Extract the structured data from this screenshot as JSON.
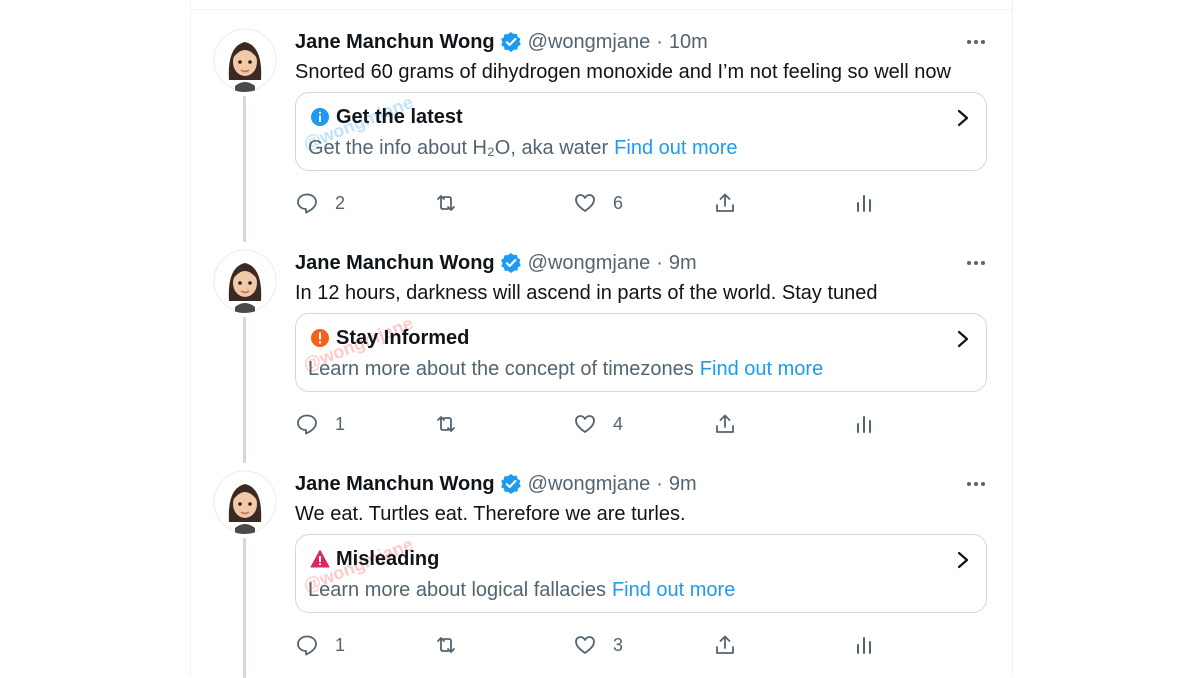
{
  "colors": {
    "accent": "#1d9bf0",
    "text": "#0f1419",
    "secondary": "#536471",
    "border": "#cfd9de",
    "thread_line": "#cfd9de",
    "info_icon": "#1d9bf0",
    "stay_informed_icon": "#f4631e",
    "misleading_icon": "#e0245e"
  },
  "watermark": "@wongmjane",
  "tweets": [
    {
      "author": {
        "name": "Jane Manchun Wong",
        "handle": "@wongmjane",
        "verified": true,
        "avatar_icon": "memoji-avatar-icon"
      },
      "time": "10m",
      "text": "Snorted 60 grams of dihydrogen monoxide and I’m not feeling so well now",
      "card": {
        "icon": "info-icon",
        "title": "Get the latest",
        "body": "Get the info about H₂O, aka water",
        "link": "Find out more"
      },
      "actions": {
        "replies": "2",
        "retweets": "",
        "likes": "6"
      }
    },
    {
      "author": {
        "name": "Jane Manchun Wong",
        "handle": "@wongmjane",
        "verified": true,
        "avatar_icon": "memoji-avatar-icon"
      },
      "time": "9m",
      "text": "In 12 hours, darkness will ascend in parts of the world. Stay tuned",
      "card": {
        "icon": "exclamation-icon",
        "title": "Stay Informed",
        "body": "Learn more about the concept of timezones",
        "link": "Find out more"
      },
      "actions": {
        "replies": "1",
        "retweets": "",
        "likes": "4"
      }
    },
    {
      "author": {
        "name": "Jane Manchun Wong",
        "handle": "@wongmjane",
        "verified": true,
        "avatar_icon": "memoji-avatar-icon"
      },
      "time": "9m",
      "text": "We eat. Turtles eat. Therefore we are turles.",
      "card": {
        "icon": "warning-triangle-icon",
        "title": "Misleading",
        "body": "Learn more about logical fallacies",
        "link": "Find out more"
      },
      "actions": {
        "replies": "1",
        "retweets": "",
        "likes": "3"
      }
    }
  ]
}
